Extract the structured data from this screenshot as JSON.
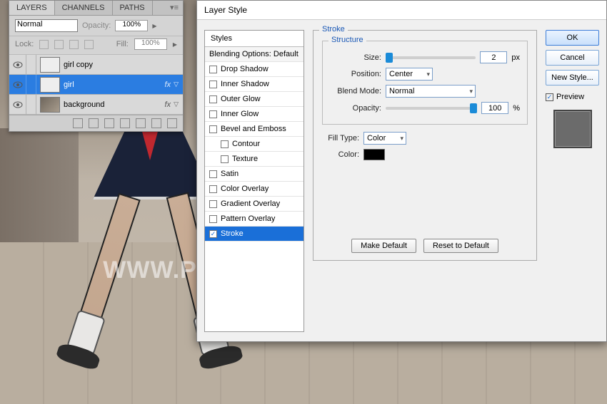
{
  "watermark": "WWW.PHOTOSHOPSUPPLY.COM",
  "layers_panel": {
    "tabs": [
      "LAYERS",
      "CHANNELS",
      "PATHS"
    ],
    "blend_mode": "Normal",
    "opacity_label": "Opacity:",
    "opacity_value": "100%",
    "lock_label": "Lock:",
    "fill_label": "Fill:",
    "fill_value": "100%",
    "layers": [
      {
        "name": "girl copy",
        "fx": false,
        "sel": false,
        "thumb": "girl"
      },
      {
        "name": "girl",
        "fx": true,
        "sel": true,
        "thumb": "girl"
      },
      {
        "name": "background",
        "fx": true,
        "sel": false,
        "thumb": "bg"
      }
    ]
  },
  "dialog": {
    "title": "Layer Style",
    "styles_header": "Styles",
    "blending_options": "Blending Options: Default",
    "style_items": [
      {
        "label": "Drop Shadow",
        "checked": false
      },
      {
        "label": "Inner Shadow",
        "checked": false
      },
      {
        "label": "Outer Glow",
        "checked": false
      },
      {
        "label": "Inner Glow",
        "checked": false
      },
      {
        "label": "Bevel and Emboss",
        "checked": false
      },
      {
        "label": "Contour",
        "checked": false,
        "indent": true
      },
      {
        "label": "Texture",
        "checked": false,
        "indent": true
      },
      {
        "label": "Satin",
        "checked": false
      },
      {
        "label": "Color Overlay",
        "checked": false
      },
      {
        "label": "Gradient Overlay",
        "checked": false
      },
      {
        "label": "Pattern Overlay",
        "checked": false
      },
      {
        "label": "Stroke",
        "checked": true,
        "sel": true
      }
    ],
    "stroke_legend": "Stroke",
    "structure_legend": "Structure",
    "size_label": "Size:",
    "size_value": "2",
    "size_unit": "px",
    "position_label": "Position:",
    "position_value": "Center",
    "blendmode_label": "Blend Mode:",
    "blendmode_value": "Normal",
    "opacity_label": "Opacity:",
    "opacity_value": "100",
    "opacity_unit": "%",
    "filltype_label": "Fill Type:",
    "filltype_value": "Color",
    "color_label": "Color:",
    "color_value": "#000000",
    "make_default": "Make Default",
    "reset_default": "Reset to Default",
    "ok": "OK",
    "cancel": "Cancel",
    "new_style": "New Style...",
    "preview_label": "Preview"
  }
}
